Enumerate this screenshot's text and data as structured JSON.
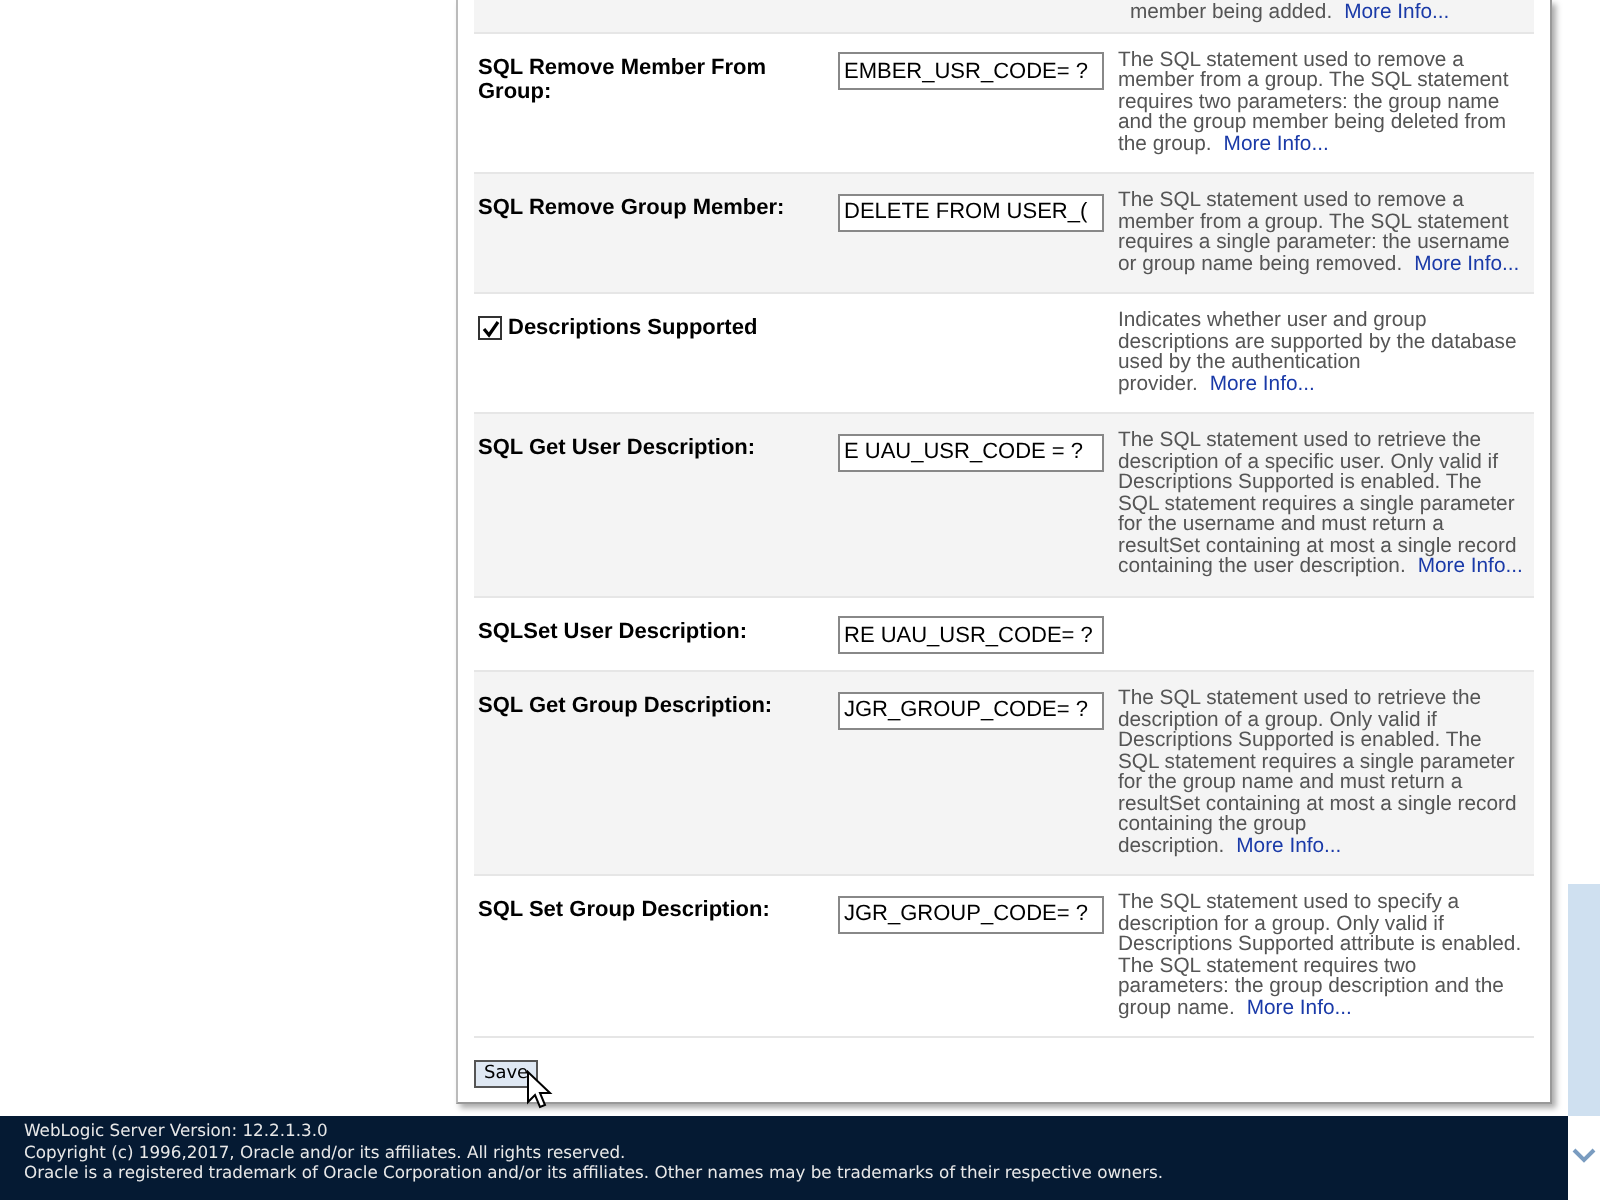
{
  "partial_row": {
    "description": "member being added.",
    "link": "More Info..."
  },
  "rows": [
    {
      "kind": "field",
      "label": "SQL Remove Member From Group:",
      "value": "EMBER_USR_CODE= ?",
      "description": "The SQL statement used to remove a member from a group. The SQL statement requires two parameters: the group name and the group member being deleted from the group.",
      "link": "More Info..."
    },
    {
      "kind": "field",
      "label": "SQL Remove Group Member:",
      "value": "DELETE FROM USER_(",
      "description": "The SQL statement used to remove a member from a group. The SQL statement requires a single parameter: the username or group name being removed.",
      "link": "More Info..."
    },
    {
      "kind": "checkbox",
      "label": "Descriptions Supported",
      "checked": true,
      "description": "Indicates whether user and group descriptions are supported by the database used by the authentication provider.",
      "link": "More Info..."
    },
    {
      "kind": "field",
      "label": "SQL Get User Description:",
      "value": "E UAU_USR_CODE = ?",
      "description": "The SQL statement used to retrieve the description of a specific user. Only valid if Descriptions Supported is enabled. The SQL statement requires a single parameter for the username and must return a resultSet containing at most a single record containing the user description.",
      "link": "More Info..."
    },
    {
      "kind": "field",
      "label": "SQLSet User Description:",
      "value": "RE UAU_USR_CODE= ?"
    },
    {
      "kind": "field",
      "label": "SQL Get Group Description:",
      "value": "JGR_GROUP_CODE= ?",
      "description": "The SQL statement used to retrieve the description of a group. Only valid if Descriptions Supported is enabled. The SQL statement requires a single parameter for the group name and must return a resultSet containing at most a single record containing the group description.",
      "link": "More Info..."
    },
    {
      "kind": "field",
      "label": "SQL Set Group Description:",
      "value": "JGR_GROUP_CODE= ?",
      "description": "The SQL statement used to specify a description for a group. Only valid if Descriptions Supported attribute is enabled. The SQL statement requires two parameters: the group description and the group name.",
      "link": "More Info..."
    }
  ],
  "save_button": "Save",
  "footer": [
    "WebLogic Server Version: 12.2.1.3.0",
    "Copyright (c) 1996,2017, Oracle and/or its affiliates. All rights reserved.",
    "Oracle is a registered trademark of Oracle Corporation and/or its affiliates. Other names may be trademarks of their respective owners."
  ]
}
